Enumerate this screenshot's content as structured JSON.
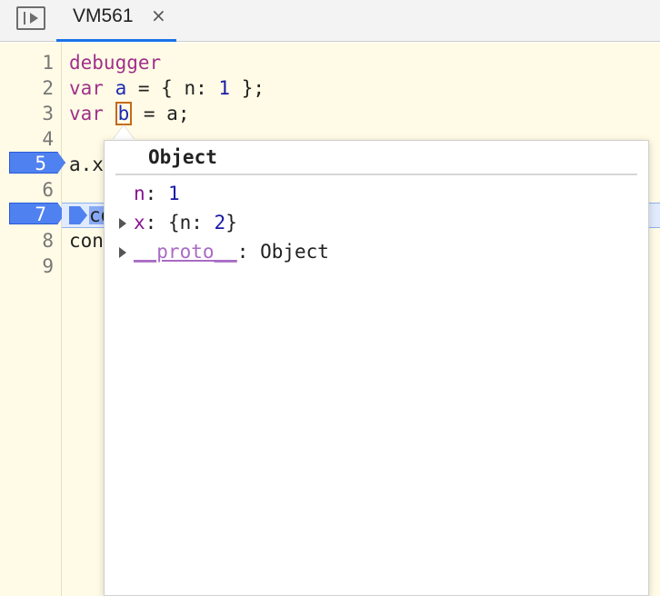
{
  "tabbar": {
    "toggle_icon": "navigator-toggle-icon",
    "tab_label": "VM561",
    "close_glyph": "×"
  },
  "editor": {
    "line_numbers": [
      "1",
      "2",
      "3",
      "4",
      "5",
      "6",
      "7",
      "8",
      "9"
    ],
    "breakpoints": [
      "5",
      "7"
    ],
    "lines": {
      "l1": "debugger",
      "l2_kw": "var",
      "l2_var": "a",
      "l2_rest": " = { n: ",
      "l2_num": "1",
      "l2_end": " };",
      "l3_kw": "var",
      "l3_var": "b",
      "l3_rest": " = a;",
      "l5": "a.x",
      "l7": "co",
      "l8": "con"
    }
  },
  "popover": {
    "title": "Object",
    "props": [
      {
        "key": "n",
        "sep": ": ",
        "value": "1"
      },
      {
        "key": "x",
        "sep": ": ",
        "value_pre": "{n: ",
        "value_num": "2",
        "value_post": "}"
      },
      {
        "key": "__proto__",
        "sep": ": ",
        "value": "Object"
      }
    ]
  }
}
